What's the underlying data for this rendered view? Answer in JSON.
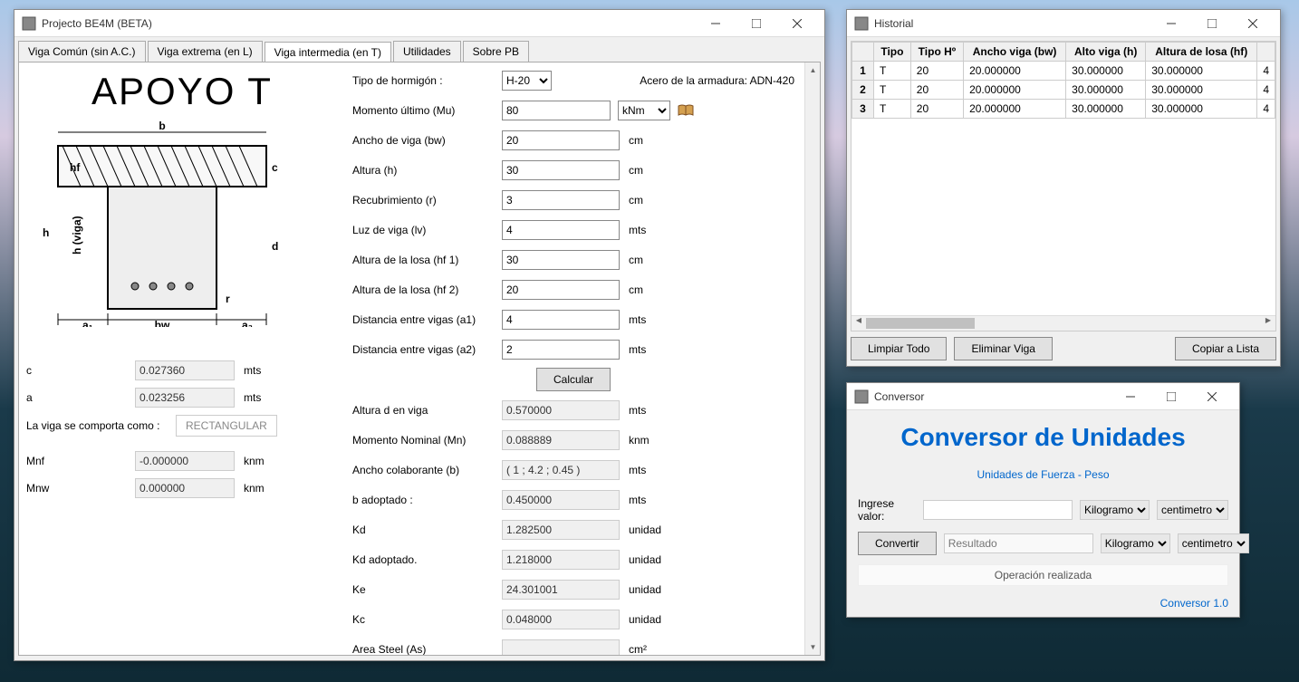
{
  "main": {
    "title": "Projecto BE4M  (BETA)",
    "tabs": [
      "Viga Común (sin A.C.)",
      "Viga extrema (en L)",
      "Viga intermedia (en T)",
      "Utilidades",
      "Sobre PB"
    ],
    "diagram_title": "APOYO T",
    "left_labels": {
      "c": "c",
      "a": "a",
      "behave": "La viga se comporta como :",
      "mnf": "Mnf",
      "mnw": "Mnw"
    },
    "left_values": {
      "c": "0.027360",
      "a": "0.023256",
      "shape": "RECTANGULAR",
      "mnf": "-0.000000",
      "mnw": "0.000000"
    },
    "left_units": {
      "c": "mts",
      "a": "mts",
      "mnf": "knm",
      "mnw": "knm"
    },
    "right": {
      "tipoH_label": "Tipo de hormigón :",
      "tipoH_value": "H-20",
      "acero_label": "Acero de la armadura: ADN-420",
      "mu_label": "Momento último (Mu)",
      "mu_value": "80",
      "mu_unit": "kNm",
      "bw_label": "Ancho de viga (bw)",
      "bw_value": "20",
      "bw_unit": "cm",
      "h_label": "Altura (h)",
      "h_value": "30",
      "h_unit": "cm",
      "r_label": "Recubrimiento (r)",
      "r_value": "3",
      "r_unit": "cm",
      "lv_label": "Luz de viga (lv)",
      "lv_value": "4",
      "lv_unit": "mts",
      "hf1_label": "Altura de la losa (hf 1)",
      "hf1_value": "30",
      "hf1_unit": "cm",
      "hf2_label": "Altura de la losa (hf 2)",
      "hf2_value": "20",
      "hf2_unit": "cm",
      "a1_label": "Distancia entre vigas (a1)",
      "a1_value": "4",
      "a1_unit": "mts",
      "a2_label": "Distancia entre vigas (a2)",
      "a2_value": "2",
      "a2_unit": "mts",
      "calc_label": "Calcular",
      "d_label": "Altura d en viga",
      "d_value": "0.570000",
      "d_unit": "mts",
      "mn_label": "Momento Nominal (Mn)",
      "mn_value": "0.088889",
      "mn_unit": "knm",
      "bcol_label": "Ancho colaborante (b)",
      "bcol_value": "( 1 ; 4.2 ; 0.45 )",
      "bcol_unit": "mts",
      "badop_label": "b adoptado :",
      "badop_value": "0.450000",
      "badop_unit": "mts",
      "kd_label": "Kd",
      "kd_value": "1.282500",
      "kd_unit": "unidad",
      "kdadop_label": "Kd adoptado.",
      "kdadop_value": "1.218000",
      "kdadop_unit": "unidad",
      "ke_label": "Ke",
      "ke_value": "24.301001",
      "ke_unit": "unidad",
      "kc_label": "Kc",
      "kc_value": "0.048000",
      "kc_unit": "unidad",
      "as_label": "Area Steel (As)",
      "as_unit": "cm²"
    }
  },
  "historial": {
    "title": "Historial",
    "headers": [
      "Tipo",
      "Tipo Hº",
      "Ancho viga (bw)",
      "Alto viga (h)",
      "Altura de losa (hf)"
    ],
    "rows": [
      {
        "idx": "1",
        "tipo": "T",
        "tipoH": "20",
        "bw": "20.000000",
        "h": "30.000000",
        "hf": "30.000000",
        "extra": "4"
      },
      {
        "idx": "2",
        "tipo": "T",
        "tipoH": "20",
        "bw": "20.000000",
        "h": "30.000000",
        "hf": "30.000000",
        "extra": "4"
      },
      {
        "idx": "3",
        "tipo": "T",
        "tipoH": "20",
        "bw": "20.000000",
        "h": "30.000000",
        "hf": "30.000000",
        "extra": "4"
      }
    ],
    "btn_clear": "Limpiar Todo",
    "btn_del": "Eliminar Viga",
    "btn_copy": "Copiar a Lista"
  },
  "conversor": {
    "title": "Conversor",
    "heading": "Conversor de Unidades",
    "subtitle": "Unidades de Fuerza - Peso",
    "input_label": "Ingrese valor:",
    "convert_btn": "Convertir",
    "result_placeholder": "Resultado",
    "unit1": "Kilogramo",
    "unit2": "centimetro",
    "status": "Operación realizada",
    "footer": "Conversor 1.0"
  }
}
